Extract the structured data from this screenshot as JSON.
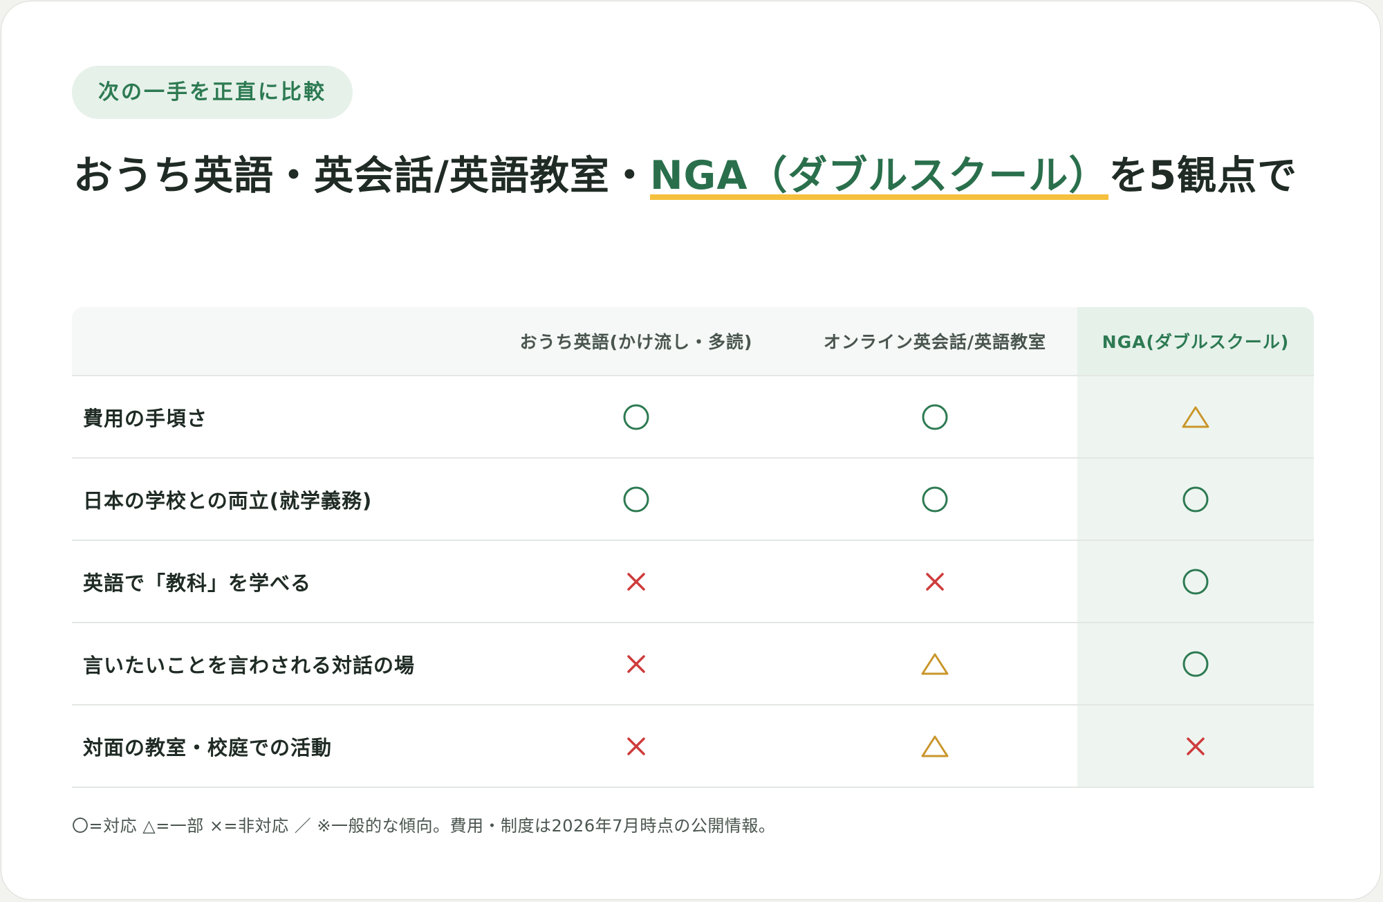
{
  "tag": "次の一手を正直に比較",
  "title": {
    "part1": "おうち英語・英会話/英語教室・",
    "highlight": "NGA（ダブルスクール）",
    "part2": "を5観点で"
  },
  "colors": {
    "accent_green": "#2d7a52",
    "highlight_underline": "#f5c03e",
    "circle": "#2d7a52",
    "triangle": "#c9962b",
    "cross": "#cf3b3b"
  },
  "table": {
    "columns": [
      "",
      "おうち英語(かけ流し・多読)",
      "オンライン英会話/英語教室",
      "NGA(ダブルスクール)"
    ],
    "rows": [
      {
        "label": "費用の手頃さ",
        "marks": [
          "circle",
          "circle",
          "triangle"
        ]
      },
      {
        "label": "日本の学校との両立(就学義務)",
        "marks": [
          "circle",
          "circle",
          "circle"
        ]
      },
      {
        "label": "英語で「教科」を学べる",
        "marks": [
          "cross",
          "cross",
          "circle"
        ]
      },
      {
        "label": "言いたいことを言わされる対話の場",
        "marks": [
          "cross",
          "triangle",
          "circle"
        ]
      },
      {
        "label": "対面の教室・校庭での活動",
        "marks": [
          "cross",
          "triangle",
          "cross"
        ]
      }
    ]
  },
  "legend": "〇=対応 △=一部 ×=非対応 ／ ※一般的な傾向。費用・制度は2026年7月時点の公開情報。"
}
